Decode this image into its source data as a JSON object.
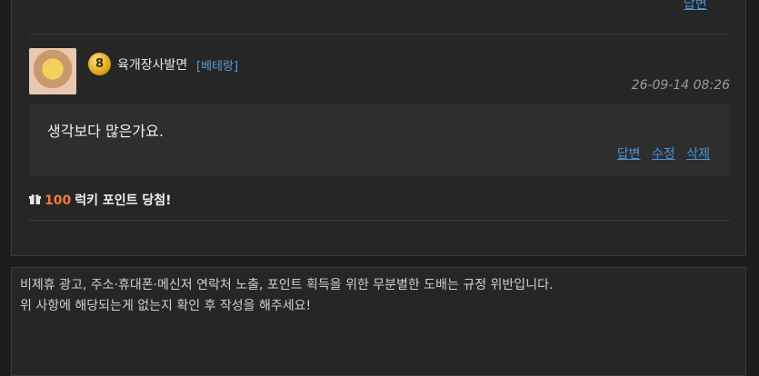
{
  "top_reply_label": "답변",
  "comment": {
    "level": "8",
    "nickname": "육개장사발면",
    "rank": "[베테랑]",
    "timestamp": "26-09-14 08:26",
    "text": "생각보다 많은가요.",
    "actions": [
      "답변",
      "수정",
      "삭제"
    ]
  },
  "lucky": {
    "icon": "gift-icon",
    "points": "100",
    "text": "럭키 포인트 당첨!"
  },
  "compose": {
    "placeholder_line1": "비제휴 광고, 주소·휴대폰·메신저 연락처 노출, 포인트 획득을 위한 무분별한 도배는 규정 위반입니다.",
    "placeholder_line2": "위 사항에 해당되는게 없는지 확인 후 작성을 해주세요!"
  },
  "colors": {
    "link": "#4a90d9",
    "rank": "#5a9bd8",
    "points": "#f07a3b"
  }
}
